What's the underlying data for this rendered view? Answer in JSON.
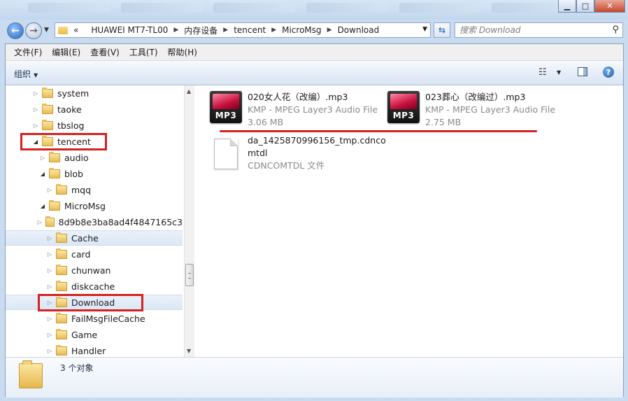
{
  "window": {
    "minimize_glyph": "▁",
    "maximize_glyph": "□",
    "close_glyph": "✕"
  },
  "address_bar": {
    "overflow_glyph": "«",
    "breadcrumbs": [
      "HUAWEI MT7-TL00",
      "内存设备",
      "tencent",
      "MicroMsg",
      "Download"
    ],
    "separator": "▶",
    "dropdown_glyph": "▼",
    "refresh_glyph": "⇆"
  },
  "search": {
    "placeholder": "搜索 Download",
    "icon": "magnifier-icon"
  },
  "menu": {
    "items": [
      "文件(F)",
      "编辑(E)",
      "查看(V)",
      "工具(T)",
      "帮助(H)"
    ]
  },
  "toolbar": {
    "organize_label": "组织",
    "dropdown_glyph": "▼",
    "help_glyph": "?"
  },
  "tree": {
    "items": [
      {
        "label": "system",
        "expanded": false
      },
      {
        "label": "taoke",
        "expanded": false
      },
      {
        "label": "tbslog",
        "expanded": false
      },
      {
        "label": "tencent",
        "expanded": true
      },
      {
        "label": "audio",
        "expanded": false
      },
      {
        "label": "blob",
        "expanded": true
      },
      {
        "label": "mqq",
        "expanded": false
      },
      {
        "label": "MicroMsg",
        "expanded": true
      },
      {
        "label": "8d9b8e3ba8ad4f4847165c3",
        "expanded": false
      },
      {
        "label": "Cache",
        "expanded": false
      },
      {
        "label": "card",
        "expanded": false
      },
      {
        "label": "chunwan",
        "expanded": false
      },
      {
        "label": "diskcache",
        "expanded": false
      },
      {
        "label": "Download",
        "expanded": false,
        "selected": true
      },
      {
        "label": "FailMsgFileCache",
        "expanded": false
      },
      {
        "label": "Game",
        "expanded": false
      },
      {
        "label": "Handler",
        "expanded": false
      }
    ]
  },
  "files": [
    {
      "name": "020女人花（改编）.mp3",
      "type": "KMP - MPEG Layer3 Audio File",
      "size": "3.06 MB",
      "icon_text": "MP3"
    },
    {
      "name": "023葬心（改编过）.mp3",
      "type": "KMP - MPEG Layer3 Audio File",
      "size": "2.75 MB",
      "icon_text": "MP3"
    },
    {
      "name_line1": "da_1425870996156_tmp.cdnco",
      "name_line2": "mtdl",
      "type": "CDNCOMTDL 文件"
    }
  ],
  "status": {
    "count": "3 个对象"
  },
  "colors": {
    "highlight_red": "#d62121",
    "selection": "#dbe7f6"
  }
}
